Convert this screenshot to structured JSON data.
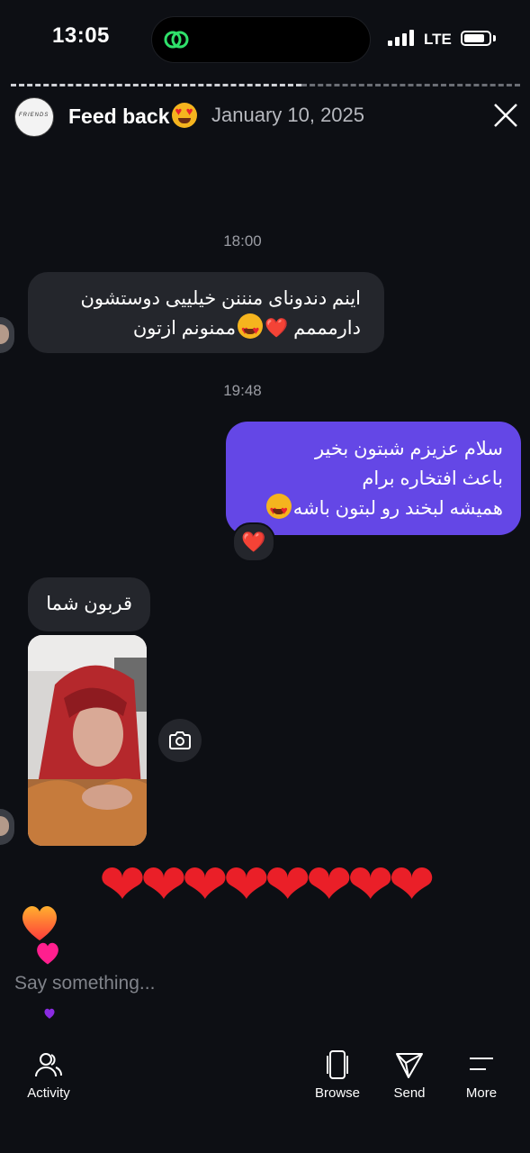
{
  "status_bar": {
    "time": "13:05",
    "network": "LTE"
  },
  "header": {
    "avatar_text": "FRIENDS",
    "title": "Feed back",
    "title_emoji": "heart-eyes-emoji",
    "date": "January 10, 2025",
    "close_icon": "close-icon"
  },
  "story_progress": {
    "viewed_fraction": 0.57
  },
  "messages": [
    {
      "type": "timestamp",
      "text": "18:00"
    },
    {
      "type": "incoming",
      "lines": [
        "اینم دندونای منننن خیلییی دوستشون",
        "دارمممم ❤️",
        "ممنونم ازتون"
      ]
    },
    {
      "type": "timestamp",
      "text": "19:48"
    },
    {
      "type": "outgoing",
      "lines": [
        "سلام عزیزم شبتون بخیر",
        "باعث افتخاره برام",
        "همیشه لبخند رو لبتون باشه"
      ],
      "reaction": "❤️"
    },
    {
      "type": "incoming",
      "lines": [
        "قربون شما"
      ]
    },
    {
      "type": "photo",
      "icon": "camera-icon"
    }
  ],
  "hearts_row": "❤❤❤❤❤❤❤❤",
  "composer": {
    "placeholder": "Say something..."
  },
  "bottom_nav": [
    {
      "label": "Activity",
      "icon": "people-icon"
    },
    {
      "label": "Browse",
      "icon": "cards-icon"
    },
    {
      "label": "Send",
      "icon": "send-icon"
    },
    {
      "label": "More",
      "icon": "menu-icon"
    }
  ],
  "colors": {
    "background": "#0d0f14",
    "outgoing_bubble": "#6447e6",
    "incoming_bubble": "#24262c",
    "heart": "#ea1f28"
  }
}
